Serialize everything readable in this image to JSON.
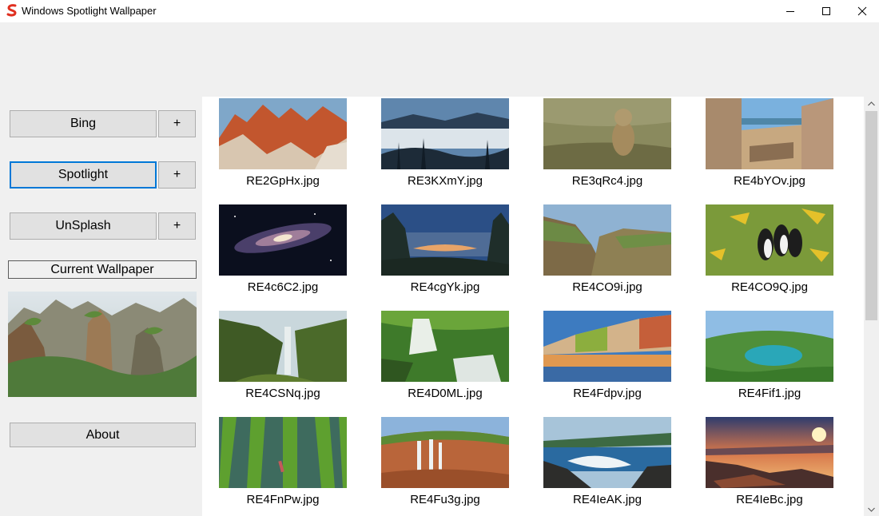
{
  "window": {
    "title": "Windows Spotlight Wallpaper",
    "accent": "#0078d7"
  },
  "sidebar": {
    "sources": [
      {
        "label": "Bing",
        "add_label": "+",
        "active": false
      },
      {
        "label": "Spotlight",
        "add_label": "+",
        "active": true
      },
      {
        "label": "UnSplash",
        "add_label": "+",
        "active": false
      }
    ],
    "current_wallpaper_label": "Current Wallpaper",
    "about_label": "About"
  },
  "gallery": {
    "items": [
      "RE2GpHx.jpg",
      "RE3KXmY.jpg",
      "RE3qRc4.jpg",
      "RE4bYOv.jpg",
      "RE4c6C2.jpg",
      "RE4cgYk.jpg",
      "RE4CO9i.jpg",
      "RE4CO9Q.jpg",
      "RE4CSNq.jpg",
      "RE4D0ML.jpg",
      "RE4Fdpv.jpg",
      "RE4Fif1.jpg",
      "RE4FnPw.jpg",
      "RE4Fu3g.jpg",
      "RE4IeAK.jpg",
      "RE4IeBc.jpg"
    ]
  }
}
